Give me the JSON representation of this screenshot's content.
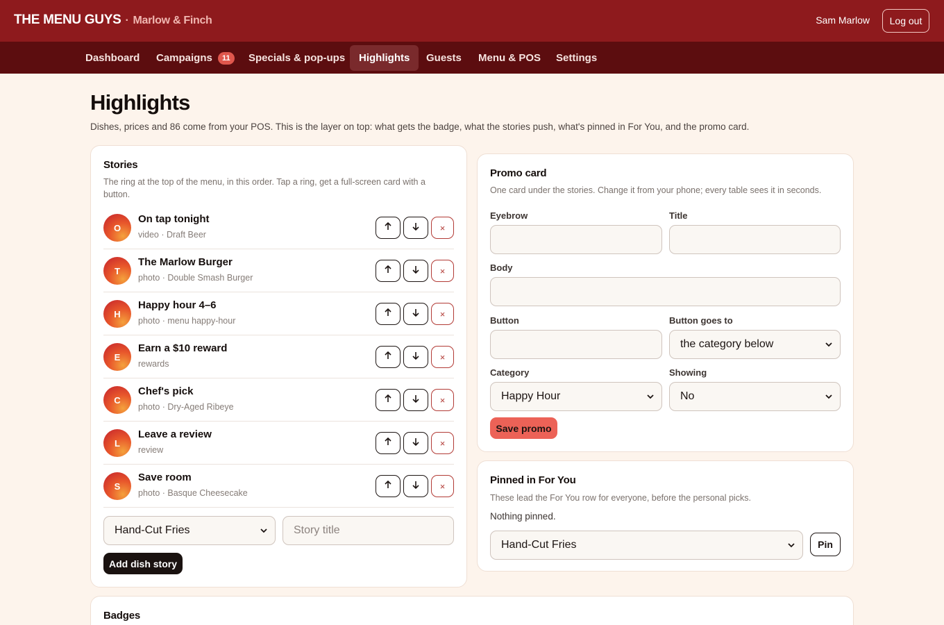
{
  "brand": {
    "name": "THE MENU GUYS",
    "separator": "·",
    "venue": "Marlow & Finch"
  },
  "user": {
    "name": "Sam Marlow",
    "logout_label": "Log out"
  },
  "nav": {
    "items": [
      {
        "label": "Dashboard"
      },
      {
        "label": "Campaigns",
        "count": "11"
      },
      {
        "label": "Specials & pop-ups"
      },
      {
        "label": "Highlights",
        "active": true
      },
      {
        "label": "Guests"
      },
      {
        "label": "Menu & POS"
      },
      {
        "label": "Settings"
      }
    ]
  },
  "page": {
    "title": "Highlights",
    "description": "Dishes, prices and 86 come from your POS. This is the layer on top: what gets the badge, what the stories push, what's pinned in For You, and the promo card."
  },
  "stories": {
    "title": "Stories",
    "description": "The ring at the top of the menu, in this order. Tap a ring, get a full-screen card with a button.",
    "items": [
      {
        "initial": "O",
        "title": "On tap tonight",
        "meta": "video · Draft Beer"
      },
      {
        "initial": "T",
        "title": "The Marlow Burger",
        "meta": "photo · Double Smash Burger"
      },
      {
        "initial": "H",
        "title": "Happy hour 4–6",
        "meta": "photo · menu happy-hour"
      },
      {
        "initial": "E",
        "title": "Earn a $10 reward",
        "meta": "rewards"
      },
      {
        "initial": "C",
        "title": "Chef's pick",
        "meta": "photo · Dry-Aged Ribeye"
      },
      {
        "initial": "L",
        "title": "Leave a review",
        "meta": "review"
      },
      {
        "initial": "S",
        "title": "Save room",
        "meta": "photo · Basque Cheesecake"
      }
    ],
    "dish_select_value": "Hand-Cut Fries",
    "story_title_placeholder": "Story title",
    "add_label": "Add dish story",
    "del_glyph": "×"
  },
  "promo": {
    "title": "Promo card",
    "description": "One card under the stories. Change it from your phone; every table sees it in seconds.",
    "eyebrow_label": "Eyebrow",
    "title_label": "Title",
    "body_label": "Body",
    "button_label": "Button",
    "button_goes_label": "Button goes to",
    "button_goes_value": "the category below",
    "category_label": "Category",
    "category_value": "Happy Hour",
    "showing_label": "Showing",
    "showing_value": "No",
    "save_label": "Save promo"
  },
  "pinned": {
    "title": "Pinned in For You",
    "description": "These lead the For You row for everyone, before the personal picks.",
    "empty_text": "Nothing pinned.",
    "select_value": "Hand-Cut Fries",
    "pin_label": "Pin"
  },
  "badges": {
    "title": "Badges"
  },
  "colors": {
    "topbar": "#8e1a1d",
    "navbar": "#5c0d0f",
    "accent": "#ec6257",
    "page_bg": "#fdf4ec"
  }
}
